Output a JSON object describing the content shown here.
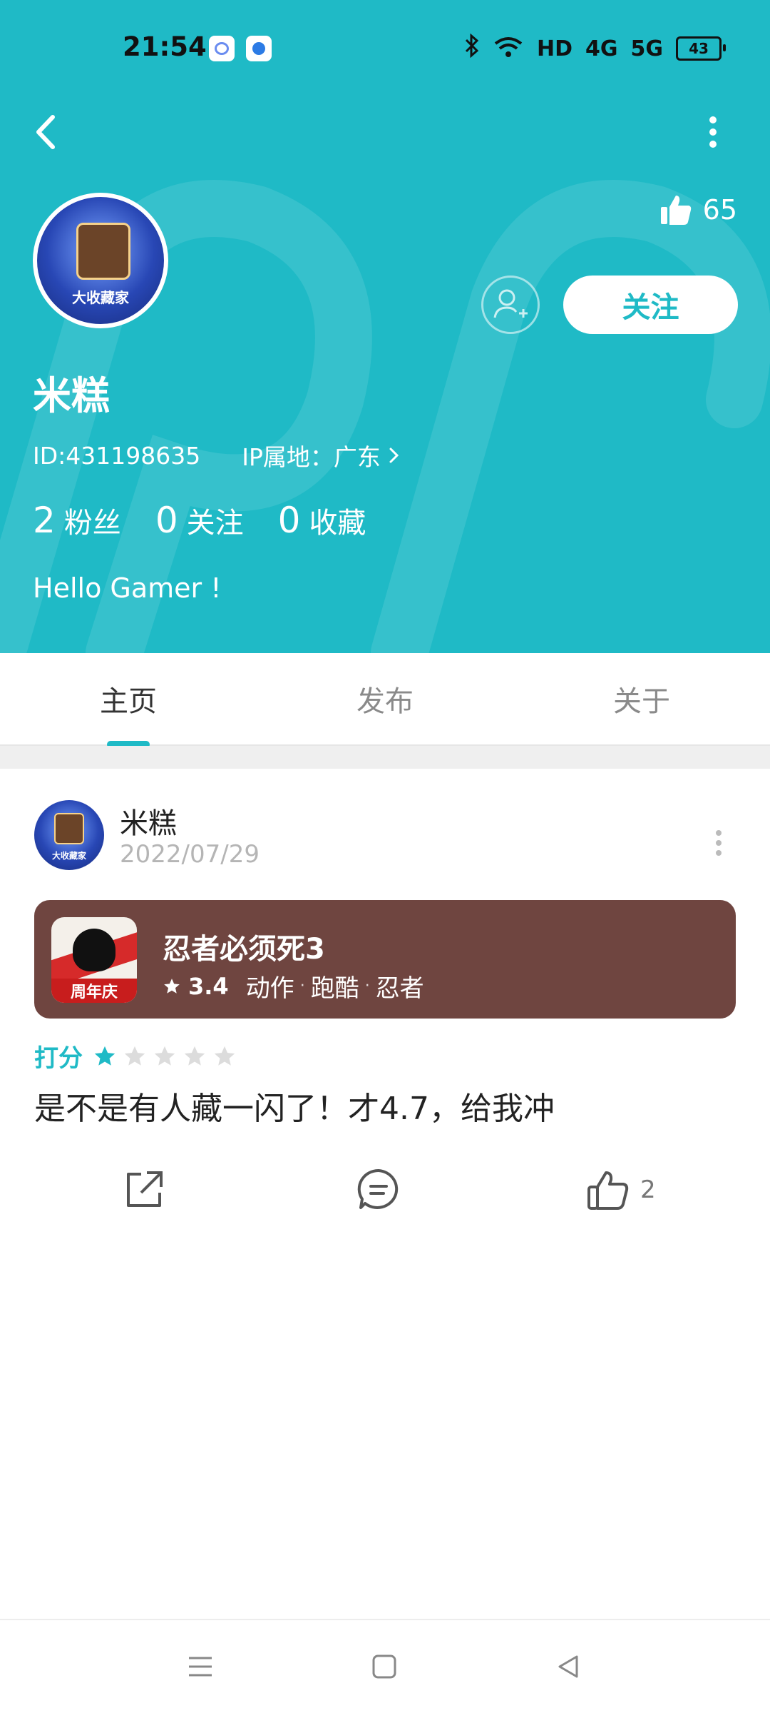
{
  "status_bar": {
    "time": "21:54",
    "network_hd": "HD",
    "network_4g": "4G",
    "network_5g": "5G",
    "battery": "43"
  },
  "header": {
    "like_count": "65",
    "follow_label": "关注",
    "avatar_caption": "大收藏家",
    "username": "米糕",
    "id_text": "ID:431198635",
    "ip_text": "IP属地：广东",
    "stats": [
      {
        "num": "2",
        "label": "粉丝"
      },
      {
        "num": "0",
        "label": "关注"
      },
      {
        "num": "0",
        "label": "收藏"
      }
    ],
    "bio": "Hello Gamer !",
    "accent_color": "#1fbac6"
  },
  "tabs": [
    {
      "label": "主页",
      "active": true
    },
    {
      "label": "发布",
      "active": false
    },
    {
      "label": "关于",
      "active": false
    }
  ],
  "post": {
    "author": "米糕",
    "date": "2022/07/29",
    "avatar_caption": "大收藏家",
    "game": {
      "title": "忍者必须死3",
      "rating": "3.4",
      "tags": [
        "动作",
        "跑酷",
        "忍者"
      ],
      "icon_badge": "周年庆",
      "card_color": "#6f4540"
    },
    "rating_label": "打分",
    "stars_filled": 1,
    "stars_total": 5,
    "text": "是不是有人藏一闪了！才4.7，给我冲",
    "like_count": "2"
  },
  "icons": {
    "back": "back-arrow-icon",
    "more": "more-vertical-icon",
    "thumb": "thumbs-up-icon",
    "add_friend": "add-friend-icon",
    "share": "share-icon",
    "comment": "comment-icon",
    "nav_menu": "menu-icon",
    "nav_home": "home-square-icon",
    "nav_back": "back-triangle-icon"
  }
}
